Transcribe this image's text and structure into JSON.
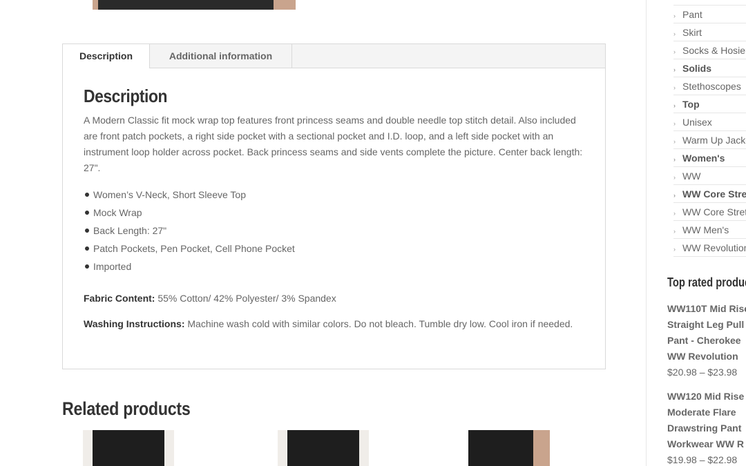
{
  "tabs": [
    {
      "label": "Description",
      "active": true
    },
    {
      "label": "Additional information",
      "active": false
    }
  ],
  "description": {
    "heading": "Description",
    "paragraph": "A Modern Classic fit mock wrap top features front princess seams and double needle top stitch detail. Also included are front patch pockets, a right side pocket with a sectional pocket and I.D. loop, and a left side pocket with an instrument loop holder across pocket. Back princess seams and side vents complete the picture. Center back length: 27\".",
    "features": [
      "Women’s V-Neck, Short Sleeve Top",
      "Mock Wrap",
      "Back Length: 27\"",
      "Patch Pockets, Pen Pocket, Cell Phone Pocket",
      "Imported"
    ],
    "fabric_label": "Fabric Content:",
    "fabric_value": " 55% Cotton/ 42% Polyester/ 3% Spandex",
    "washing_label": "Washing Instructions:",
    "washing_value": " Machine wash cold with similar colors. Do not bleach. Tumble dry low. Cool iron if needed."
  },
  "related": {
    "title": "Related products"
  },
  "sidebar": {
    "categories": [
      {
        "label": "Pant",
        "bold": false
      },
      {
        "label": "Skirt",
        "bold": false
      },
      {
        "label": "Socks & Hosiery",
        "bold": false
      },
      {
        "label": "Solids",
        "bold": true
      },
      {
        "label": "Stethoscopes",
        "bold": false
      },
      {
        "label": "Top",
        "bold": true
      },
      {
        "label": "Unisex",
        "bold": false
      },
      {
        "label": "Warm Up Jackets",
        "bold": false
      },
      {
        "label": "Women's",
        "bold": true
      },
      {
        "label": "WW",
        "bold": false
      },
      {
        "label": "WW Core Stretch",
        "bold": true
      },
      {
        "label": "WW Core Stretch",
        "bold": false
      },
      {
        "label": "WW Men's",
        "bold": false
      },
      {
        "label": "WW Revolution",
        "bold": false
      }
    ],
    "top_rated_title": "Top rated products",
    "top_rated": [
      {
        "name_lines": [
          "WW110T Mid Rise",
          "Straight Leg Pull",
          "Pant - Cherokee",
          "WW Revolution"
        ],
        "price": "$20.98 – $23.98"
      },
      {
        "name_lines": [
          "WW120 Mid Rise",
          "Moderate Flare",
          "Drawstring Pant",
          "Workwear WW R"
        ],
        "price": "$19.98 – $22.98"
      }
    ]
  },
  "colors": {
    "heading": "#333333",
    "text": "#666666",
    "border": "#d9d9d9"
  }
}
